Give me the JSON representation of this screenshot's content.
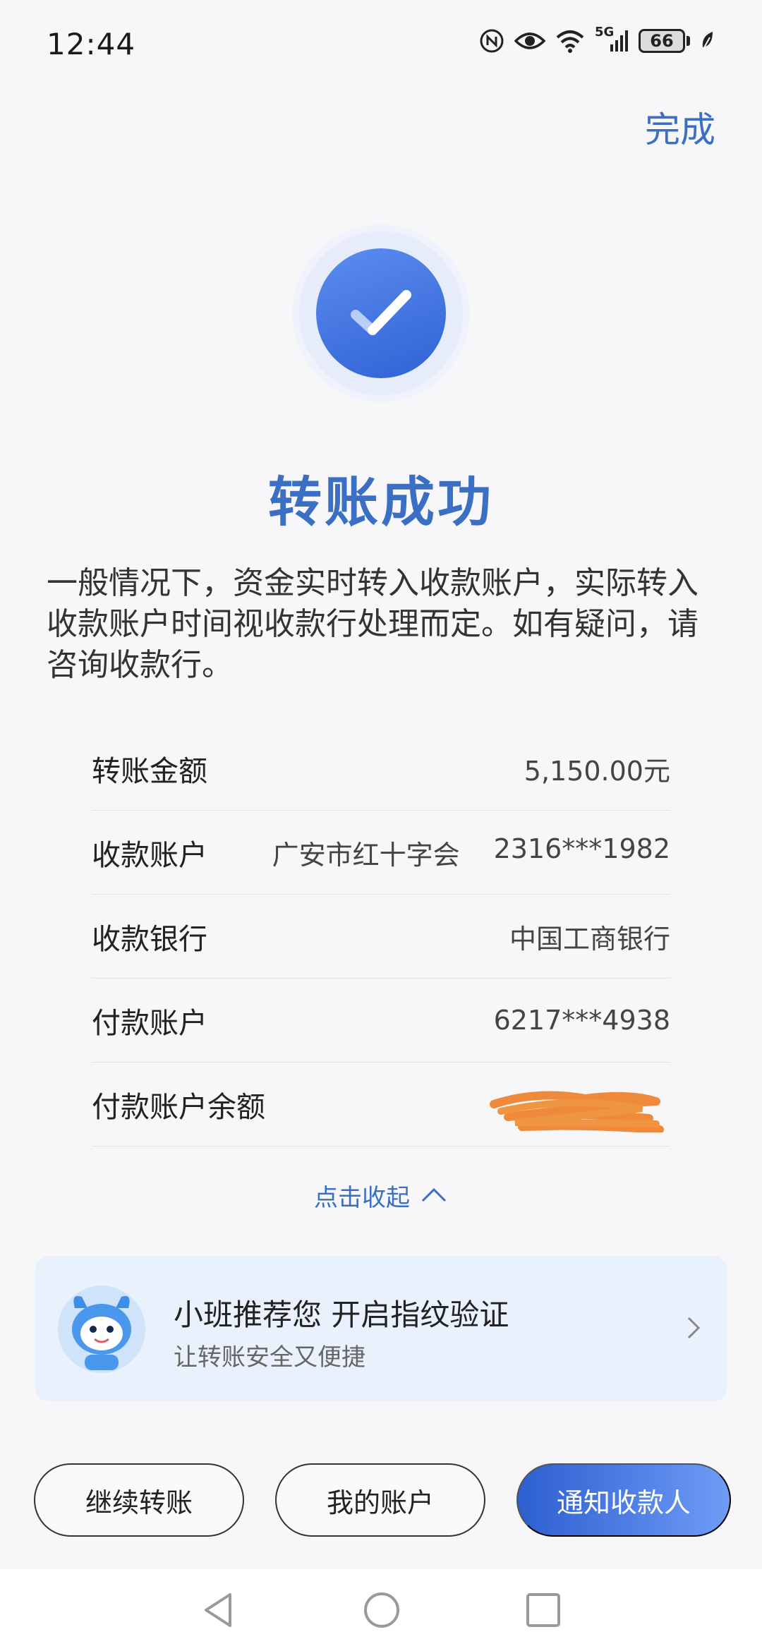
{
  "status_bar": {
    "time": "12:44",
    "network": "5G",
    "battery": "66",
    "icons": [
      "nfc-icon",
      "eye-icon",
      "wifi-icon",
      "signal-icon",
      "battery-icon",
      "leaf-icon"
    ]
  },
  "header": {
    "done_label": "完成"
  },
  "result": {
    "icon": "check-icon",
    "title": "转账成功",
    "notice": "一般情况下，资金实时转入收款账户，实际转入收款账户时间视收款行处理而定。如有疑问，请咨询收款行。"
  },
  "details": [
    {
      "label": "转账金额",
      "value": "5,150.00元"
    },
    {
      "label": "收款账户",
      "name": "广安市红十字会",
      "value": "2316***1982"
    },
    {
      "label": "收款银行",
      "value": "中国工商银行"
    },
    {
      "label": "付款账户",
      "value": "6217***4938"
    },
    {
      "label": "付款账户余额",
      "value": ""
    }
  ],
  "collapse_label": "点击收起",
  "promo": {
    "title": "小班推荐您 开启指纹验证",
    "subtitle": "让转账安全又便捷"
  },
  "buttons": {
    "continue": "继续转账",
    "my_account": "我的账户",
    "notify": "通知收款人"
  },
  "colors": {
    "accent": "#3a6fc4",
    "promo_bg": "#e8f1fc",
    "redaction": "#ef8a3c"
  }
}
